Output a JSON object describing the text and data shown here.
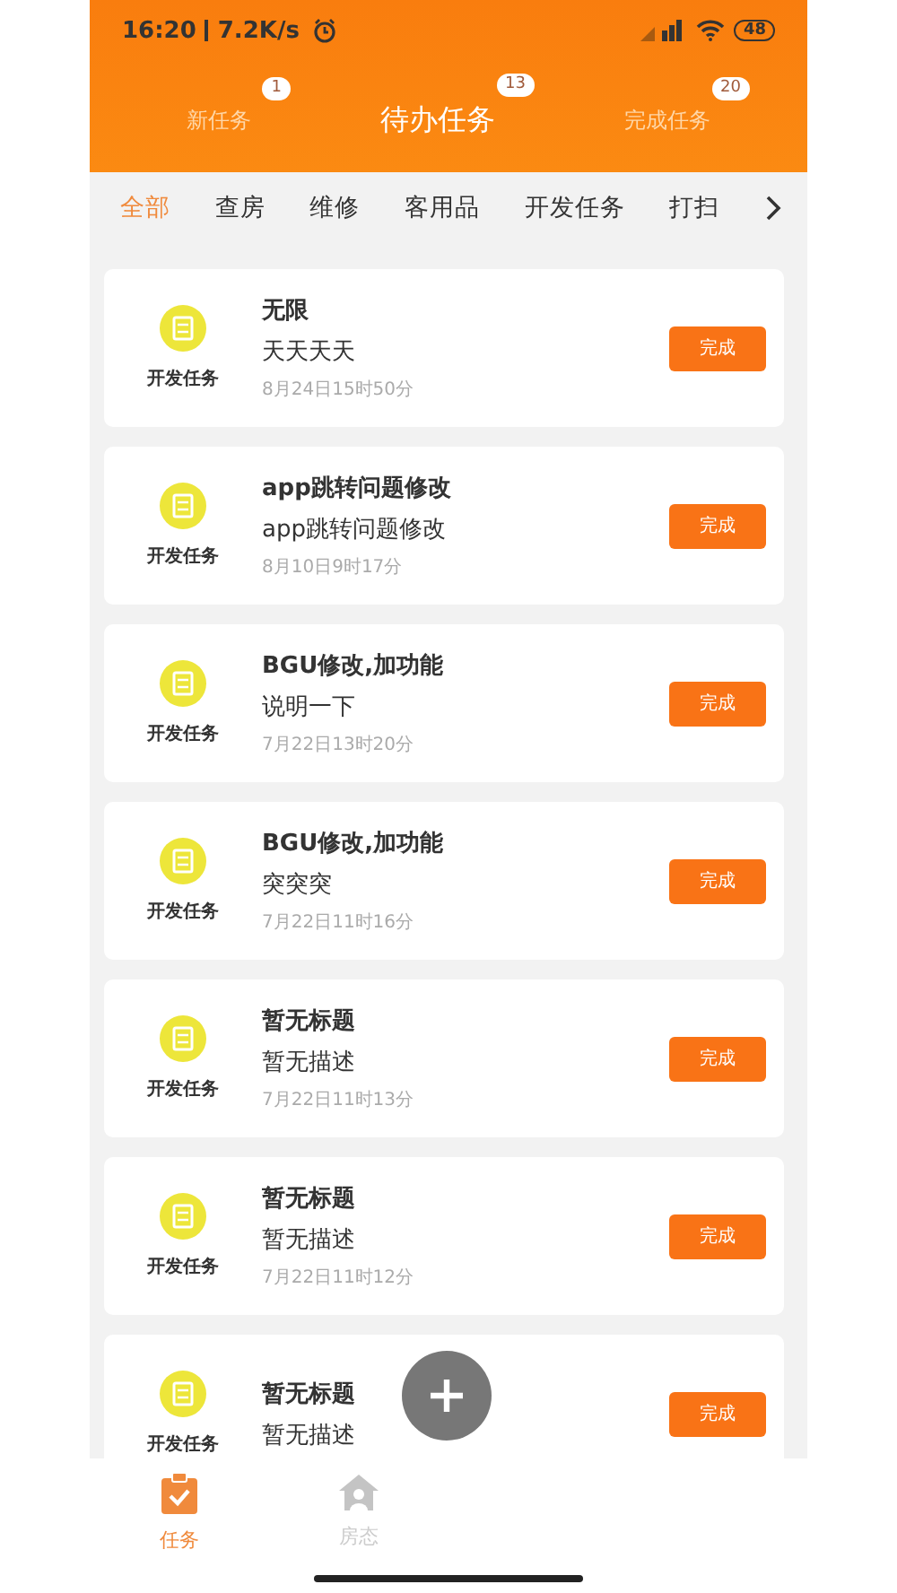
{
  "status_bar": {
    "time": "16:20",
    "speed": "7.2K/s",
    "battery": "48"
  },
  "tabs": [
    {
      "label": "新任务",
      "count": "1",
      "selected": false
    },
    {
      "label": "待办任务",
      "count": "13",
      "selected": true
    },
    {
      "label": "完成任务",
      "count": "20",
      "selected": false
    }
  ],
  "categories": [
    {
      "label": "全部",
      "selected": true
    },
    {
      "label": "查房",
      "selected": false
    },
    {
      "label": "维修",
      "selected": false
    },
    {
      "label": "客用品",
      "selected": false
    },
    {
      "label": "开发任务",
      "selected": false
    },
    {
      "label": "打扫",
      "selected": false
    }
  ],
  "tasks": [
    {
      "type": "开发任务",
      "title": "无限",
      "description": "天天天天",
      "time": "8月24日15时50分",
      "action": "完成"
    },
    {
      "type": "开发任务",
      "title": "app跳转问题修改",
      "description": "app跳转问题修改",
      "time": "8月10日9时17分",
      "action": "完成"
    },
    {
      "type": "开发任务",
      "title": "BGU修改,加功能",
      "description": "说明一下",
      "time": "7月22日13时20分",
      "action": "完成"
    },
    {
      "type": "开发任务",
      "title": "BGU修改,加功能",
      "description": "突突突",
      "time": "7月22日11时16分",
      "action": "完成"
    },
    {
      "type": "开发任务",
      "title": "暂无标题",
      "description": "暂无描述",
      "time": "7月22日11时13分",
      "action": "完成"
    },
    {
      "type": "开发任务",
      "title": "暂无标题",
      "description": "暂无描述",
      "time": "7月22日11时12分",
      "action": "完成"
    },
    {
      "type": "开发任务",
      "title": "暂无标题",
      "description": "暂无描述",
      "action": "完成"
    }
  ],
  "bottom_nav": [
    {
      "label": "任务",
      "selected": true
    },
    {
      "label": "房态",
      "selected": false
    }
  ]
}
